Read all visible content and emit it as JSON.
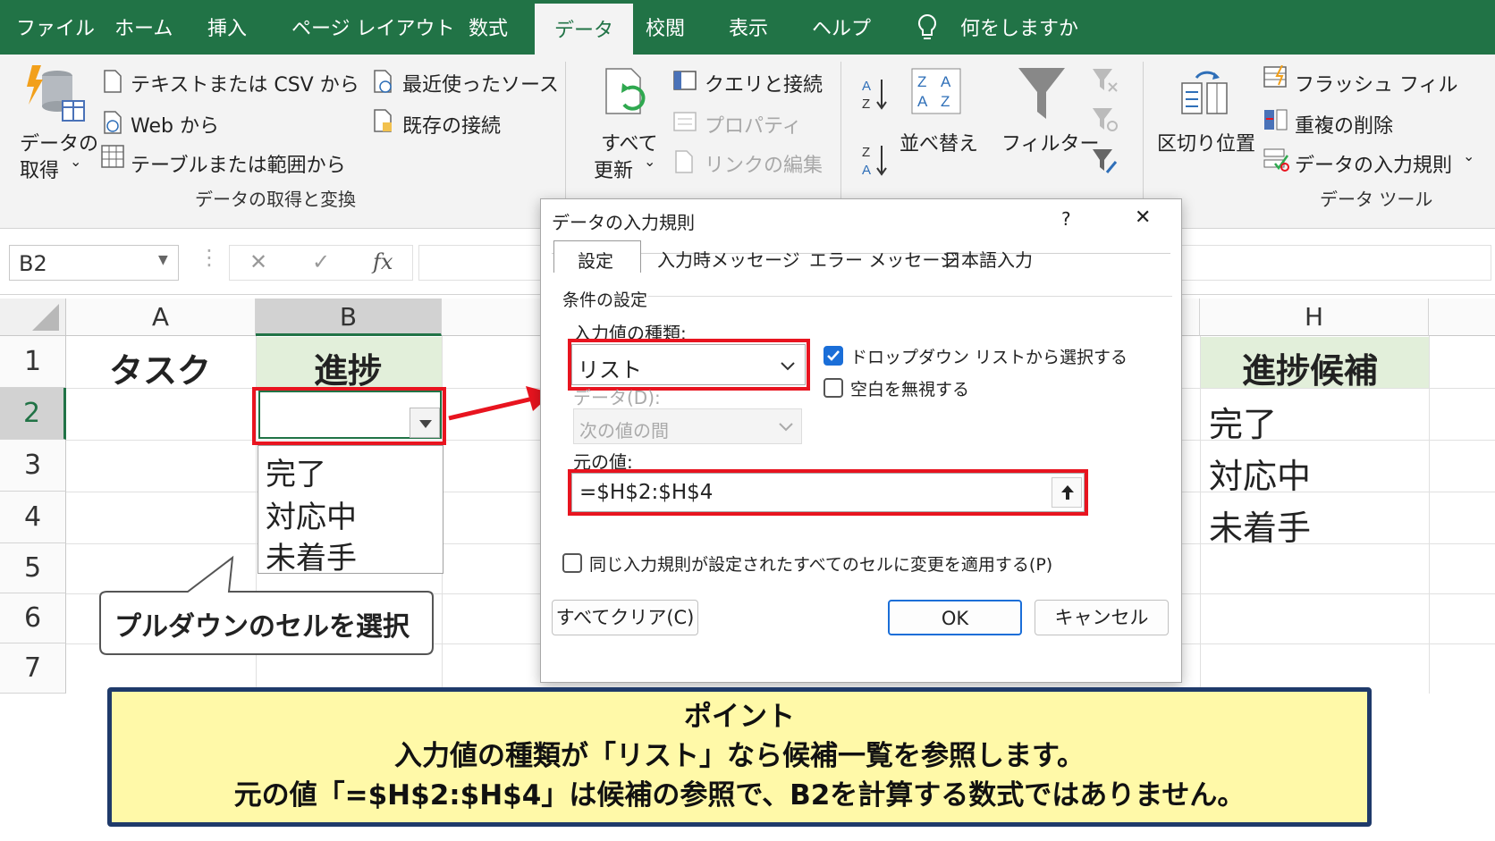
{
  "menu": {
    "file": "ファイル",
    "home": "ホーム",
    "insert": "挿入",
    "layout": "ページ レイアウト",
    "formulas": "数式",
    "data": "データ",
    "review": "校閲",
    "view": "表示",
    "help": "ヘルプ",
    "tellme": "何をしますか"
  },
  "ribbon": {
    "get_data": "データの",
    "get_data2": "取得",
    "from_text": "テキストまたは CSV から",
    "from_web": "Web から",
    "from_table": "テーブルまたは範囲から",
    "recent": "最近使ったソース",
    "existing": "既存の接続",
    "group1": "データの取得と変換",
    "refresh1": "すべて",
    "refresh2": "更新",
    "queries": "クエリと接続",
    "properties": "プロパティ",
    "links": "リンクの編集",
    "sort": "並べ替え",
    "filter": "フィルター",
    "text_to_col": "区切り位置",
    "flash_fill": "フラッシュ フィル",
    "remove_dup": "重複の削除",
    "validation": "データの入力規則",
    "group_tools": "データ ツール"
  },
  "formula_bar": {
    "name_box": "B2",
    "cancel": "✕",
    "enter": "✓",
    "fx": "fx"
  },
  "sheet": {
    "col_a": "A",
    "col_b": "B",
    "col_h": "H",
    "rows": [
      "1",
      "2",
      "3",
      "4",
      "5",
      "6",
      "7"
    ],
    "a1": "タスク",
    "b1": "進捗",
    "h1": "進捗候補",
    "h_values": [
      "完了",
      "対応中",
      "未着手"
    ],
    "dropdown_items": [
      "完了",
      "対応中",
      "未着手"
    ]
  },
  "callout": "プルダウンのセルを選択",
  "dialog": {
    "title": "データの入力規則",
    "help": "?",
    "close": "✕",
    "tabs": [
      "設定",
      "入力時メッセージ",
      "エラー メッセージ",
      "日本語入力"
    ],
    "section": "条件の設定",
    "allow_label": "入力値の種類:",
    "allow_value": "リスト",
    "data_label": "データ(D):",
    "data_value": "次の値の間",
    "dropdown_check": "ドロップダウン リストから選択する",
    "ignore_blank": "空白を無視する",
    "source_label": "元の値:",
    "source_value": "=$H$2:$H$4",
    "apply_all": "同じ入力規則が設定されたすべてのセルに変更を適用する(P)",
    "clear_all": "すべてクリア(C)",
    "ok": "OK",
    "cancel": "キャンセル"
  },
  "note": {
    "line1": "ポイント",
    "line2": "入力値の種類が「リスト」なら候補一覧を参照します。",
    "line3": "元の値「=$H$2:$H$4」は候補の参照で、B2を計算する数式ではありません。"
  },
  "colors": {
    "excel_green": "#217346",
    "highlight": "#e8141f",
    "note_bg": "#fff9a8",
    "note_border": "#1f3a6a",
    "header_fill": "#e2efda",
    "checkbox_blue": "#1a6ed8"
  }
}
